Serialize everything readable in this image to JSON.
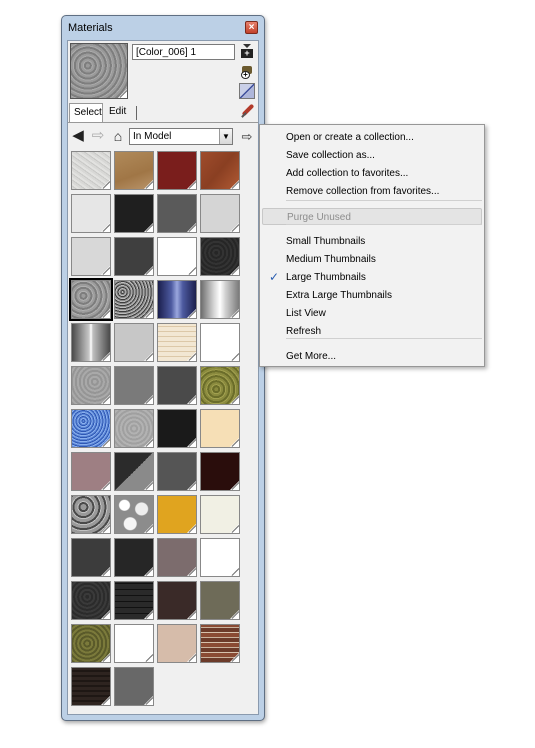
{
  "window": {
    "title": "Materials",
    "close_icon": "close-icon"
  },
  "material": {
    "name": "[Color_006] 1"
  },
  "tabs": {
    "select": "Select",
    "edit": "Edit"
  },
  "collection": {
    "value": "In Model",
    "dropdown_glyph": "▼"
  },
  "icons": {
    "back": "◀",
    "forward": "⇨",
    "home": "⌂",
    "details": "⇨",
    "new_badge": "+",
    "paint_badge": "+"
  },
  "tiles": [
    "tex-plaster",
    "tex-wood",
    "tex-red",
    "tex-rust",
    "tex-w1",
    "tex-k1",
    "tex-g5",
    "tex-g8",
    "tex-g9",
    "tex-g3",
    "tex-white",
    "tex-dark",
    "tex-concrete",
    "tex-granite",
    "tex-blue",
    "tex-steel",
    "tex-cyl",
    "tex-lg",
    "tex-brick",
    "tex-white",
    "tex-c2",
    "tex-g6",
    "tex-g4",
    "tex-moss",
    "tex-bluegran",
    "tex-c3",
    "tex-blk",
    "tex-cream",
    "tex-mauve",
    "tex-half",
    "tex-g55",
    "tex-darkred",
    "tex-rock",
    "tex-pebble",
    "tex-yellow",
    "tex-ivory",
    "tex-g35",
    "tex-g2",
    "tex-mauve2",
    "tex-white",
    "tex-stone",
    "tex-dkbrick",
    "tex-brown",
    "tex-olive",
    "tex-grass",
    "tex-white",
    "tex-tan",
    "tex-redbrick",
    "tex-dkwood",
    "tex-g66"
  ],
  "selected_tile_index": 12,
  "menu": {
    "items": [
      {
        "label": "Open or create a collection...",
        "state": "normal"
      },
      {
        "label": "Save collection as...",
        "state": "normal"
      },
      {
        "label": "Add collection to favorites...",
        "state": "normal"
      },
      {
        "label": "Remove collection from favorites...",
        "state": "normal"
      },
      {
        "label": "Purge Unused",
        "state": "disabled"
      },
      {
        "label": "Small Thumbnails",
        "state": "normal"
      },
      {
        "label": "Medium Thumbnails",
        "state": "normal"
      },
      {
        "label": "Large Thumbnails",
        "state": "checked"
      },
      {
        "label": "Extra Large Thumbnails",
        "state": "normal"
      },
      {
        "label": "List View",
        "state": "normal"
      },
      {
        "label": "Refresh",
        "state": "normal"
      },
      {
        "label": "Get More...",
        "state": "normal"
      }
    ],
    "check_glyph": "✓"
  }
}
